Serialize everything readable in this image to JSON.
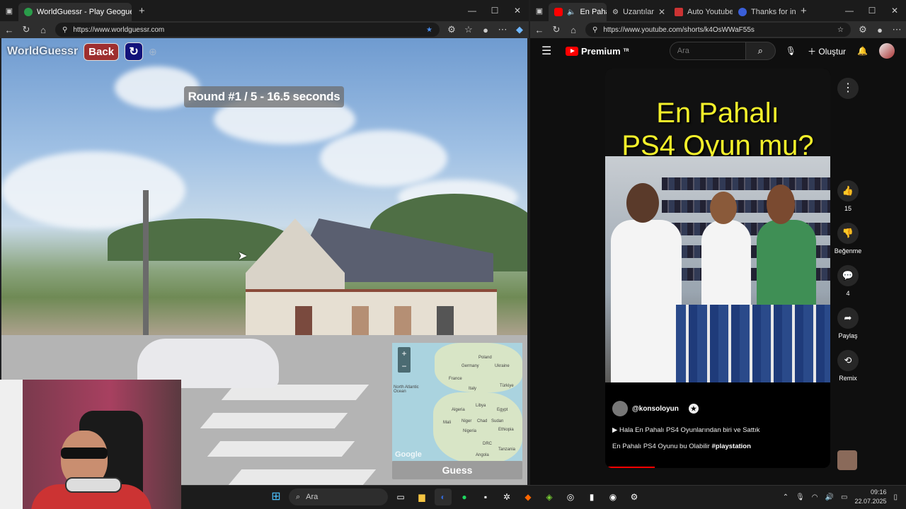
{
  "left_window": {
    "tabs": [
      {
        "label": "WorldGuessr - Play Geoguessr fo",
        "active": true
      }
    ],
    "url": "https://www.worldguessr.com",
    "game": {
      "logo": "WorldGuessr",
      "back_label": "Back",
      "round_text": "Round #1 / 5 - 16.5 seconds",
      "guess_label": "Guess",
      "map_labels": [
        "Poland",
        "Germany",
        "Ukraine",
        "France",
        "Italy",
        "Türkiye",
        "North Atlantic Ocean",
        "Algeria",
        "Libya",
        "Egypt",
        "Mali",
        "Niger",
        "Chad",
        "Sudan",
        "Ethiopia",
        "Nigeria",
        "DRC",
        "Tanzania",
        "Angola"
      ],
      "google_label": "Google",
      "zoom_in": "+",
      "zoom_out": "−"
    }
  },
  "right_window": {
    "tabs": [
      {
        "label": "En Paha",
        "active": true
      },
      {
        "label": "Uzantılar",
        "active": false
      },
      {
        "label": "Auto Youtube",
        "active": false
      },
      {
        "label": "Thanks for in",
        "active": false
      }
    ],
    "url": "https://www.youtube.com/shorts/k4OsWWaF55s",
    "youtube": {
      "premium_label": "Premium",
      "tm": "TR",
      "search_placeholder": "Ara",
      "create_label": "Oluştur",
      "short_title_line1": "En Pahalı",
      "short_title_line2": "PS4 Oyun mu?",
      "channel": "@konsoloyun",
      "subtitle": "Hala En Pahalı PS4 Oyunlarından biri ve Sattık",
      "description": "En Pahalı PS4 Oyunu bu Olabilir",
      "hashtag": "#playstation",
      "likes": "15",
      "dislike_label": "Beğenme",
      "comments": "4",
      "share_label": "Paylaş",
      "remix_label": "Remix"
    }
  },
  "taskbar": {
    "search_label": "Ara",
    "time": "09:16",
    "date": "22.07.2025"
  }
}
